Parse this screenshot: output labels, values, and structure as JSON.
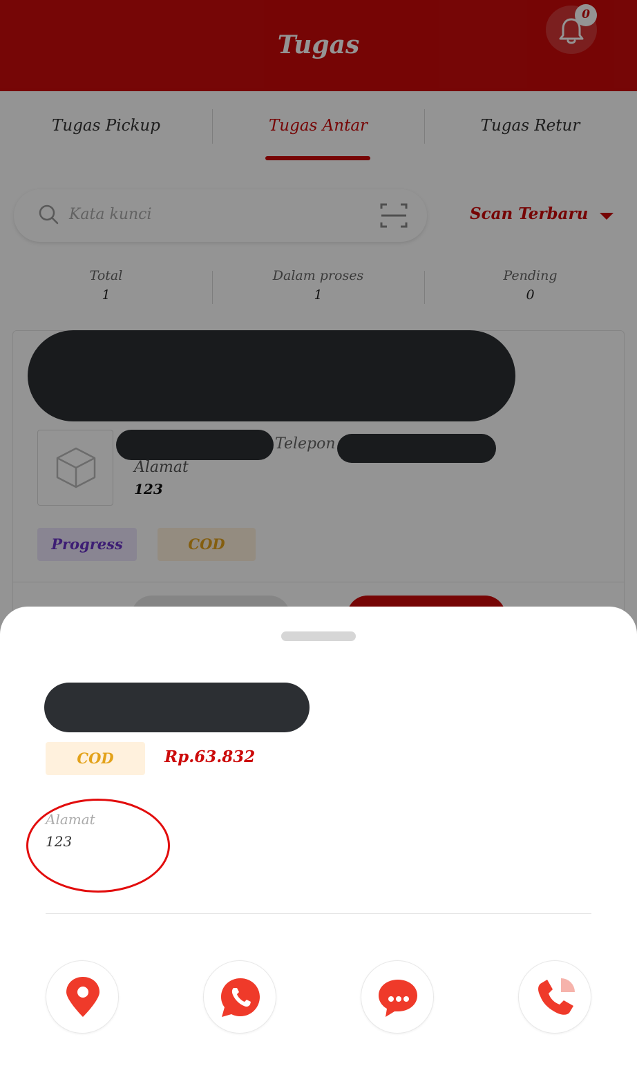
{
  "header": {
    "title": "Tugas",
    "notification_count": "0"
  },
  "tabs": [
    {
      "label": "Tugas Pickup"
    },
    {
      "label": "Tugas Antar"
    },
    {
      "label": "Tugas Retur"
    }
  ],
  "active_tab": "Tugas Antar",
  "search": {
    "placeholder": "Kata kunci"
  },
  "sort": {
    "label": "Scan Terbaru"
  },
  "stats": [
    {
      "label": "Total",
      "value": "1"
    },
    {
      "label": "Dalam proses",
      "value": "1"
    },
    {
      "label": "Pending",
      "value": "0"
    }
  ],
  "card": {
    "telepon_label": "Telepon",
    "alamat_label": "Alamat",
    "alamat_value": "123",
    "status_chip": "Progress",
    "payment_chip": "COD"
  },
  "sheet": {
    "payment_chip": "COD",
    "amount": "Rp.63.832",
    "alamat_label": "Alamat",
    "alamat_value": "123",
    "actions": [
      {
        "icon": "map-pin-icon"
      },
      {
        "icon": "whatsapp-icon"
      },
      {
        "icon": "chat-bubble-icon"
      },
      {
        "icon": "phone-call-icon"
      }
    ]
  },
  "colors": {
    "brand_red": "#cc0a0a",
    "cod_orange": "#e3a21a",
    "progress_purple": "#6a32c9",
    "action_red": "#ef3a2a",
    "redaction": "#2c2f33"
  }
}
